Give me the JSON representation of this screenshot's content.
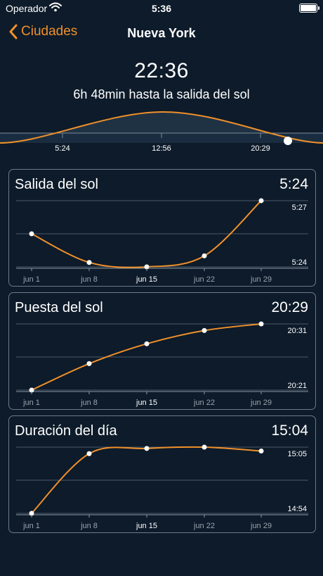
{
  "status_bar": {
    "carrier": "Operador",
    "time": "5:36"
  },
  "nav": {
    "back_label": "Ciudades",
    "title": "Nueva York"
  },
  "current_time": "22:36",
  "countdown": "6h 48min hasta la salida del sol",
  "day_graph": {
    "labels": [
      "5:24",
      "12:56",
      "20:29"
    ]
  },
  "colors": {
    "accent": "#f0902a",
    "background": "#0d1b2a",
    "card_border": "#6c7b89"
  },
  "cards": [
    {
      "label": "Salida del sol",
      "value": "5:24",
      "chart_data": {
        "type": "line",
        "x": [
          "jun 1",
          "jun 8",
          "jun 15",
          "jun 22",
          "jun 29"
        ],
        "highlight": "jun 15",
        "values": [
          5.255,
          5.242,
          5.24,
          5.245,
          5.27
        ],
        "ylim": [
          5.24,
          5.27
        ],
        "ytick_labels": [
          "5:27",
          "5:24"
        ]
      }
    },
    {
      "label": "Puesta del sol",
      "value": "20:29",
      "chart_data": {
        "type": "line",
        "x": [
          "jun 1",
          "jun 8",
          "jun 15",
          "jun 22",
          "jun 29"
        ],
        "highlight": "jun 15",
        "values": [
          20.21,
          20.25,
          20.28,
          20.3,
          20.31
        ],
        "ylim": [
          20.21,
          20.31
        ],
        "ytick_labels": [
          "20:31",
          "20:21"
        ]
      }
    },
    {
      "label": "Duración del día",
      "value": "15:04",
      "chart_data": {
        "type": "line",
        "x": [
          "jun 1",
          "jun 8",
          "jun 15",
          "jun 22",
          "jun 29"
        ],
        "highlight": "jun 15",
        "values": [
          14.54,
          15.0,
          15.04,
          15.05,
          15.02
        ],
        "ylim": [
          14.54,
          15.05
        ],
        "ytick_labels": [
          "15:05",
          "14:54"
        ]
      }
    }
  ]
}
